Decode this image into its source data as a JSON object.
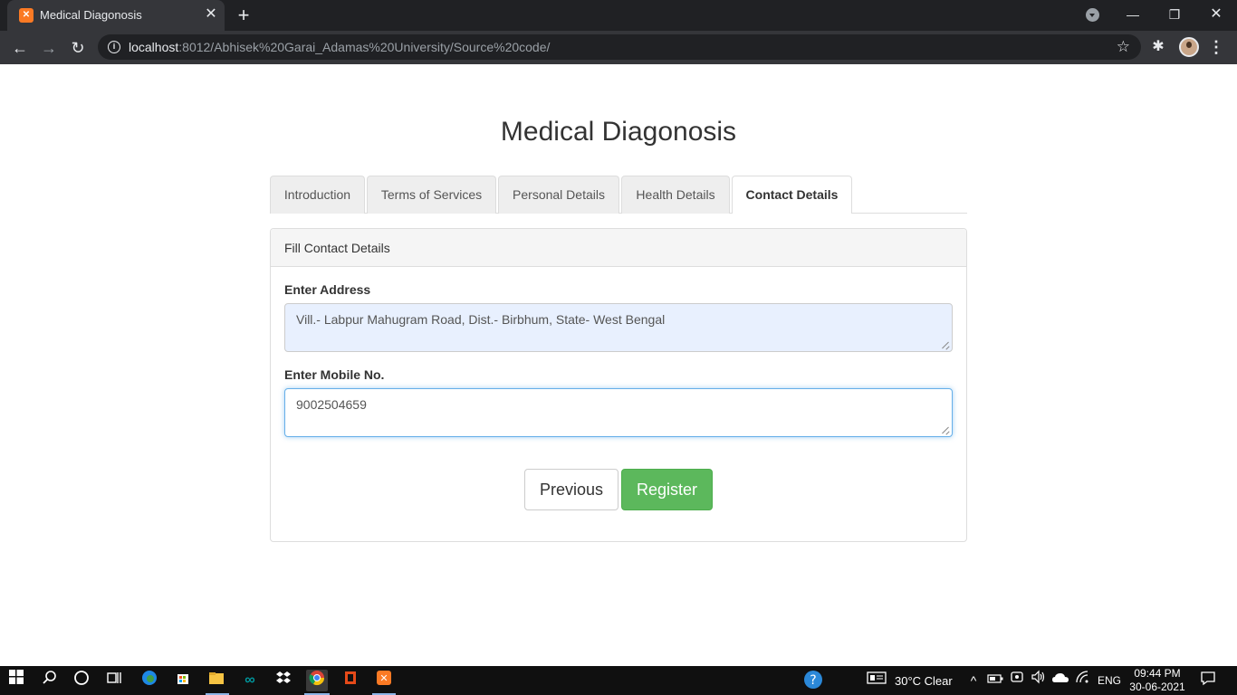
{
  "browser": {
    "tab_title": "Medical Diagonosis",
    "url_host": "localhost",
    "url_rest": ":8012/Abhisek%20Garai_Adamas%20University/Source%20code/"
  },
  "page": {
    "title": "Medical Diagonosis",
    "tabs": [
      {
        "label": "Introduction"
      },
      {
        "label": "Terms of Services"
      },
      {
        "label": "Personal Details"
      },
      {
        "label": "Health Details"
      },
      {
        "label": "Contact Details"
      }
    ],
    "active_tab": "Contact Details",
    "panel_heading": "Fill Contact Details",
    "address": {
      "label": "Enter Address",
      "value": "Vill.- Labpur Mahugram Road, Dist.- Birbhum, State- West Bengal"
    },
    "mobile": {
      "label": "Enter Mobile No.",
      "value": "9002504659"
    },
    "buttons": {
      "previous": "Previous",
      "register": "Register"
    },
    "colors": {
      "register_bg": "#5cb85c",
      "autofill_bg": "#e8f0fe",
      "focus_border": "#66afe9"
    }
  },
  "taskbar": {
    "weather": "30°C  Clear",
    "language": "ENG",
    "time": "09:44 PM",
    "date": "30-06-2021",
    "pinned_apps": [
      "windows-start-icon",
      "search-icon",
      "cortana-icon",
      "task-view-icon",
      "edge-icon",
      "store-icon",
      "file-explorer-icon",
      "arduino-icon",
      "dropbox-icon",
      "chrome-icon",
      "office-icon",
      "xampp-icon"
    ]
  }
}
